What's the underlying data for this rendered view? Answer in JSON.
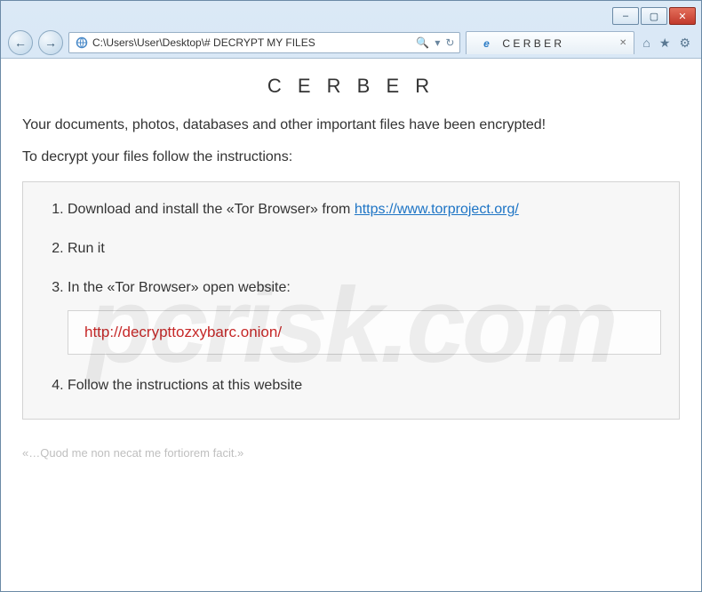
{
  "window": {
    "minimize_glyph": "–",
    "maximize_glyph": "▢",
    "close_glyph": "✕"
  },
  "toolbar": {
    "back_glyph": "←",
    "forward_glyph": "→",
    "address": "C:\\Users\\User\\Desktop\\# DECRYPT MY FILES",
    "search_glyph": "🔍",
    "dropdown_glyph": "▾",
    "refresh_glyph": "↻",
    "home_glyph": "⌂",
    "star_glyph": "★",
    "gear_glyph": "⚙"
  },
  "tab": {
    "title": "C E R B E R",
    "close_glyph": "✕",
    "ie_icon": "e"
  },
  "page": {
    "title": "C E R B E R",
    "lead1": "Your documents, photos, databases and other important files have been encrypted!",
    "lead2": "To decrypt your files follow the instructions:",
    "step1_prefix": "Download and install the «Tor Browser» from ",
    "step1_link": "https://www.torproject.org/",
    "step2": "Run it",
    "step3": "In the «Tor Browser» open website:",
    "onion_url": "http://decrypttozxybarc.onion/",
    "step4": "Follow the instructions at this website",
    "footer": "«…Quod me non necat me fortiorem facit.»",
    "watermark": "pcrisk.com"
  }
}
